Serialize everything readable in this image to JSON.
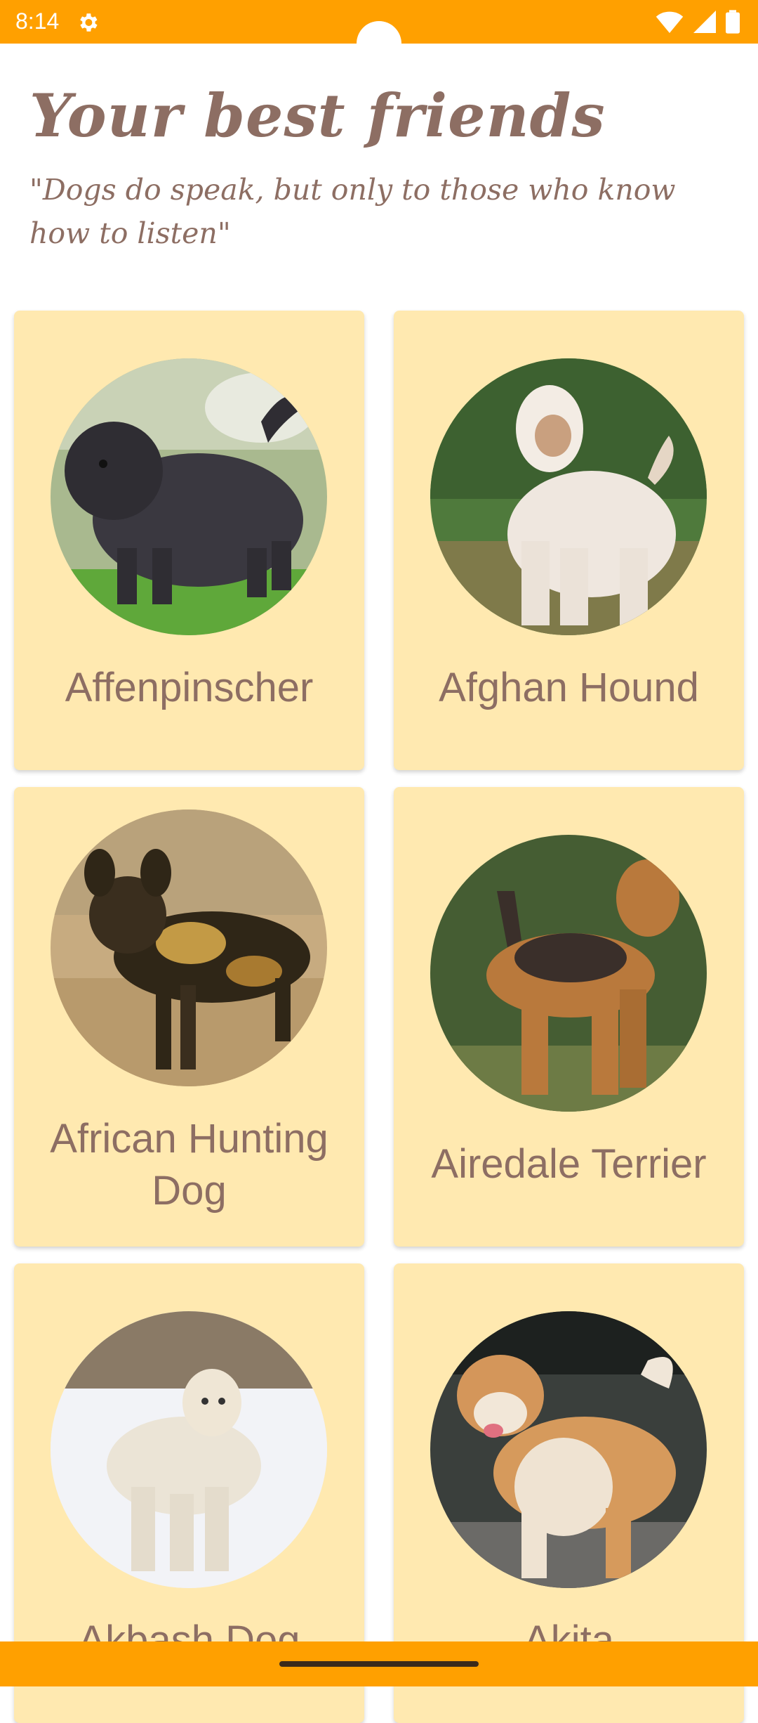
{
  "status_bar": {
    "time": "8:14",
    "icons": [
      "settings-icon",
      "wifi-icon",
      "signal-icon",
      "battery-icon"
    ]
  },
  "header": {
    "title": "Your best friends",
    "quote": "\"Dogs do speak, but only to those who know how to listen\""
  },
  "breeds": [
    {
      "name": "Affenpinscher"
    },
    {
      "name": "Afghan Hound"
    },
    {
      "name": "African Hunting Dog"
    },
    {
      "name": "Airedale Terrier"
    },
    {
      "name": "Akbash Dog"
    },
    {
      "name": "Akita"
    }
  ],
  "colors": {
    "accent": "#FFA000",
    "card": "#FFE9B0",
    "text": "#8D6E63"
  }
}
